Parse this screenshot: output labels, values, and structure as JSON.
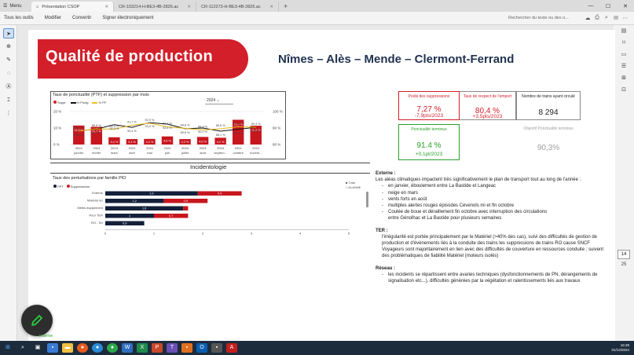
{
  "window": {
    "menu_label": "Menu",
    "tabs": [
      {
        "label": "Présentation CSOP",
        "active": true
      },
      {
        "label": "CR-103214-H-BE3-4B-2826.ac",
        "active": false
      },
      {
        "label": "CR-112273-H-BE3-4B-2826.ac",
        "active": false
      }
    ],
    "new_tab": "+",
    "controls": [
      "—",
      "☐",
      "✕"
    ]
  },
  "toolbar": {
    "items": [
      "Tous les outils",
      "Modifier",
      "Convertir",
      "Signer électroniquement"
    ],
    "search_placeholder": "Rechercher du texte ou des o..."
  },
  "page": {
    "title": "Qualité de production",
    "cities": "Nîmes – Alès – Mende – Clermont-Ferrand",
    "chart1": {
      "title": "Taux de ponctualité (PTF) et suppression par mois",
      "year_select": "2024",
      "legend": [
        "Suppr.",
        "% Pnctg",
        "% PF"
      ]
    },
    "section_title": "Incidentologie",
    "chart2": {
      "title": "Taux des perturbations par famille PIO",
      "legend": [
        "PPT",
        "Suppressions"
      ],
      "right_legend": [
        "Total",
        "ALANNE"
      ]
    },
    "kpis": {
      "suppression": {
        "label": "Poids des suppressions",
        "value": "7,27 %",
        "sub": "-7,9pts/2023"
      },
      "engagement": {
        "label": "Taux de respect de l'emport",
        "value": "80,4 %",
        "sub": "+3,5pts/2023"
      },
      "trains": {
        "label": "Nombre de trains ayant circulé",
        "value": "8 294"
      },
      "ponctualite": {
        "label": "Ponctualité terminus",
        "value": "91.4 %",
        "sub": "+0,1pt/2023"
      },
      "objectif": {
        "label": "Objectif Ponctualité terminus",
        "value": "90,3%"
      }
    },
    "notes": {
      "externe_title": "Externe :",
      "externe_intro": "Les aléas climatiques impactent très significativement le plan de transport tout au long de l'année :",
      "externe_items": [
        "en janvier, éboulement entre La Bastide et Langeac",
        "neige en mars",
        "vents forts en août",
        "multiples alertes rouges épisodes Cévenols mi et fin octobre",
        "Coulée de boue et déraillement fin octobre avec interruption des circulations"
      ],
      "externe_subline": "entre Génolhac et La Bastide pour plusieurs semaines",
      "ter_title": "TER :",
      "ter_text": "l'irrégularité est portée principalement par le Matériel (>40% des cas), suivi des difficultés de gestion de production et d'évènements liés à la conduite des trains les suppressions de trains RO cause SNCF Voyageurs sont majoritairement en lien avec des difficultés de couverture en ressources conduite ; suivent des problématiques de fiabilité Matériel (moteurs isolés)",
      "reseau_title": "Réseau :",
      "reseau_items": [
        "les incidents se répartissent entre avaries techniques (dysfonctionnements de PN, dérangements de signalisation etc...), difficultés générées par la végétation et ralentissements liés aux travaux"
      ]
    },
    "footer_label": "Interne"
  },
  "right_panel": {
    "page_current": "14",
    "page_total": "25"
  },
  "taskbar": {
    "time": "16:38",
    "date": "01/12/2024"
  },
  "chart_data": [
    {
      "type": "bar",
      "title": "Taux de ponctualité (PTF) et suppression par mois",
      "categories": [
        "2024 janvier",
        "2024 février",
        "2024 mars",
        "2024 avril",
        "2024 mai",
        "2024 juin",
        "2024 juillet",
        "2024 août",
        "2024 septem...",
        "2024 octobre",
        "2024 novem..."
      ],
      "series": [
        {
          "name": "Suppr.",
          "values": [
            11.5,
            10.7,
            4.4,
            3.3,
            3.4,
            4.9,
            3.3,
            4.6,
            4.1,
            15.0,
            11.4
          ]
        },
        {
          "name": "% Pnctg",
          "values": [
            88.2,
            89.4,
            92.0,
            90.4,
            93.3,
            92.4,
            89.6,
            90.0,
            88.1,
            89.2,
            90.4
          ]
        },
        {
          "name": "% PF",
          "values": [
            88.1,
            89.5,
            89.3,
            91.7,
            92.9,
            90.7,
            89.8,
            88.8,
            89.5,
            90.8,
            90.4
          ]
        }
      ],
      "value_labels_line1": [
        "88,1 %",
        "89,5 %",
        "89,3 %",
        "91,7 %",
        "92,9 %",
        "90,7 %",
        "89,8 %",
        "88,8 %",
        "89,5 %",
        "90,8 %",
        "90,4 %"
      ],
      "value_labels_line2": [
        "88,2 %",
        "89,4 %",
        "92,0 %",
        "90,4 %",
        "93,3 %",
        "92,4 %",
        "89,6 %",
        "90,0 %",
        "88,1 %",
        "89,2 %",
        "90,4 %"
      ],
      "bar_labels": [
        "11,5 %",
        "10,7 %",
        "4,4 %",
        "3,3 %",
        "3,4 %",
        "4,9 %",
        "3,3 %",
        "4,6 %",
        "4,1 %",
        "15,0 %",
        "11,4 %"
      ],
      "y_left_ticks": [
        "20 %",
        "10 %",
        "0 %"
      ],
      "y_right_ticks": [
        "100 %",
        "90 %",
        "80 %"
      ],
      "ylim": [
        0,
        20
      ],
      "y2lim": [
        80,
        100
      ]
    },
    {
      "type": "bar",
      "title": "Taux des perturbations par famille PIO",
      "orientation": "horizontal",
      "stacked": true,
      "categories": [
        "Externe",
        "Matériel ter",
        "Mêlés équipement",
        "Pour TER",
        "RO - Ter"
      ],
      "series": [
        {
          "name": "PPT",
          "values": [
            1.9,
            1.2,
            1.6,
            1.0,
            0.8
          ]
        },
        {
          "name": "Suppressions",
          "values": [
            0.9,
            0.9,
            0.1,
            0.7,
            0.0
          ]
        }
      ],
      "bar_labels": [
        [
          "1,9",
          "0,9"
        ],
        [
          "1,2",
          "0,9"
        ],
        [
          "1,6",
          ""
        ],
        [
          "1",
          "0,7"
        ],
        [
          "0,8",
          ""
        ]
      ],
      "x_ticks": [
        "0",
        "1",
        "2",
        "3",
        "4",
        "5"
      ],
      "xlim": [
        0,
        5
      ]
    }
  ]
}
